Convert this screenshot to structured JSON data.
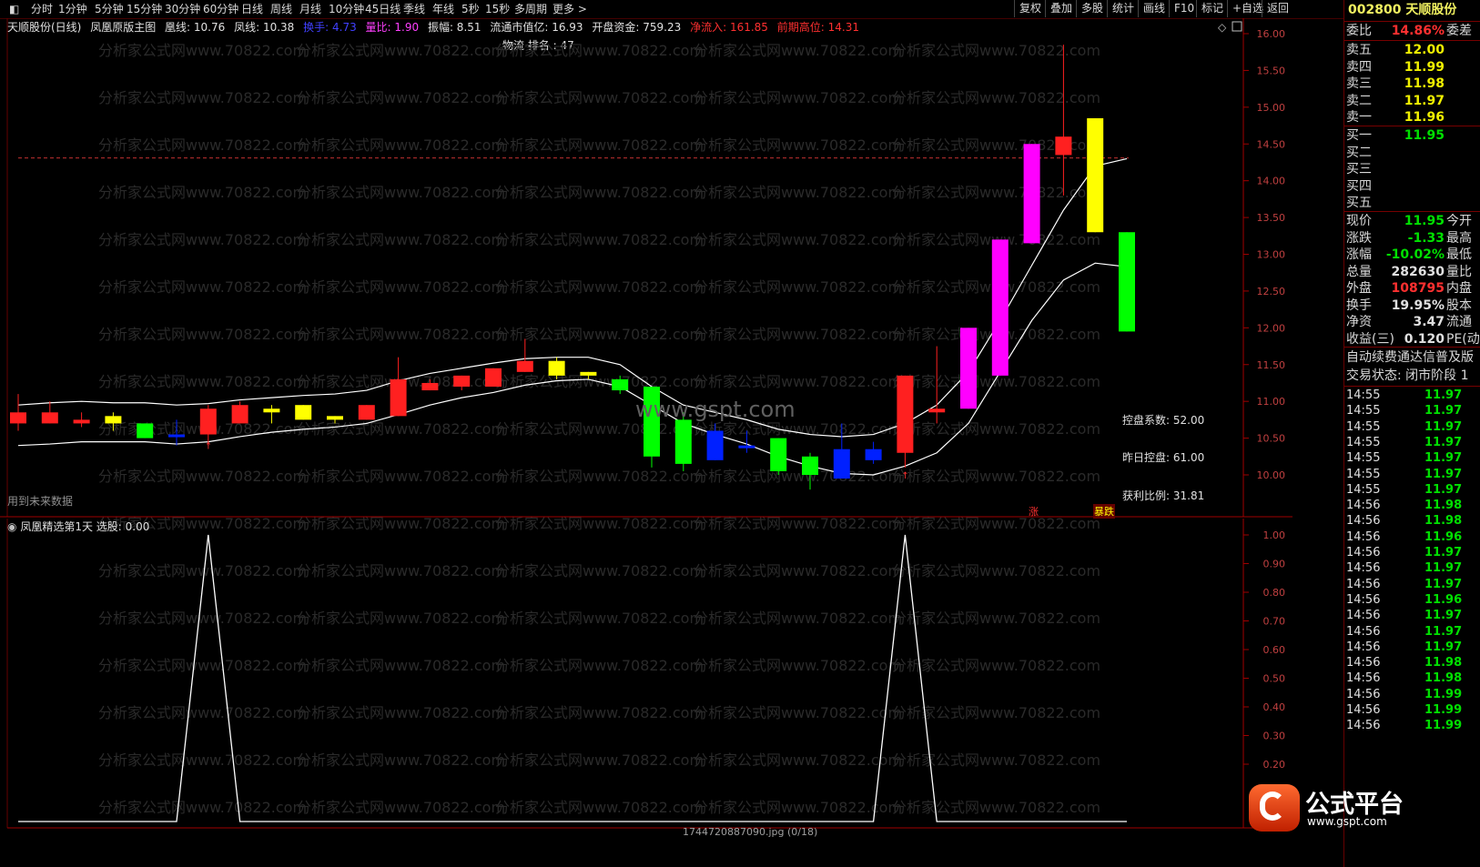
{
  "toolbar": {
    "periods": [
      "分时",
      "1分钟",
      "5分钟",
      "15分钟",
      "30分钟",
      "60分钟",
      "日线",
      "周线",
      "月线",
      "10分钟",
      "45日线",
      "季线",
      "年线",
      "5秒",
      "15秒",
      "多周期",
      "更多 >"
    ],
    "right_buttons": [
      "复权",
      "叠加",
      "多股",
      "统计",
      "画线",
      "F10",
      "标记",
      "+自选",
      "返回"
    ]
  },
  "info": {
    "stock": "天顺股份(日线)",
    "indicator": "凤凰原版主图",
    "huang": "凰线: 10.76",
    "feng": "凤线: 10.38",
    "huanshou": "换手: 4.73",
    "liangbi": "量比: 1.90",
    "zhenfu": "振幅: 8.51",
    "liutong": "流通市值亿: 16.93",
    "kaipan": "开盘资金: 759.23",
    "jingliu": "净流入: 161.85",
    "qianqi": "前期高位: 14.31",
    "wuliu": "物流 排名 : 47"
  },
  "main_chart": {
    "future_label": "用到未来数据",
    "kongpan": "控盘系数: 52.00",
    "zuori": "昨日控盘: 61.00",
    "huoli": "获利比例: 31.81",
    "zhang": "涨",
    "baodie": "暴跌",
    "watermark": "分析家公式网www.70822.com",
    "site": "www.gspt.com",
    "y_ticks": [
      "16.00",
      "15.50",
      "15.00",
      "14.50",
      "14.00",
      "13.50",
      "13.00",
      "12.50",
      "12.00",
      "11.50",
      "11.00",
      "10.50",
      "10.00"
    ],
    "colors": {
      "up": "#ff2020",
      "down": "#00ff00",
      "blue": "#0020ff",
      "yellow": "#ffff00",
      "magenta": "#ff00ff",
      "line": "#ffffff"
    },
    "candles": [
      [
        10.85,
        10.7,
        11.1,
        10.6,
        "up"
      ],
      [
        10.85,
        10.7,
        11.0,
        10.7,
        "up"
      ],
      [
        10.75,
        10.7,
        10.85,
        10.65,
        "up"
      ],
      [
        10.8,
        10.7,
        10.85,
        10.6,
        "yellow"
      ],
      [
        10.7,
        10.5,
        10.7,
        10.5,
        "down"
      ],
      [
        10.55,
        10.55,
        10.75,
        10.4,
        "blue"
      ],
      [
        10.9,
        10.55,
        10.95,
        10.4,
        "up"
      ],
      [
        10.95,
        10.7,
        11.0,
        10.7,
        "up"
      ],
      [
        10.9,
        10.85,
        10.95,
        10.7,
        "yellow"
      ],
      [
        10.95,
        10.75,
        10.95,
        10.75,
        "yellow"
      ],
      [
        10.8,
        10.75,
        10.8,
        10.7,
        "yellow"
      ],
      [
        10.95,
        10.75,
        10.95,
        10.75,
        "up"
      ],
      [
        11.3,
        10.8,
        11.6,
        10.8,
        "up"
      ],
      [
        11.25,
        11.15,
        11.3,
        11.15,
        "up"
      ],
      [
        11.35,
        11.2,
        11.35,
        11.15,
        "up"
      ],
      [
        11.45,
        11.2,
        11.45,
        11.2,
        "up"
      ],
      [
        11.55,
        11.4,
        11.85,
        11.4,
        "up"
      ],
      [
        11.55,
        11.35,
        11.6,
        11.3,
        "yellow"
      ],
      [
        11.4,
        11.35,
        11.4,
        11.3,
        "yellow"
      ],
      [
        11.3,
        11.15,
        11.35,
        11.1,
        "down"
      ],
      [
        11.2,
        10.25,
        11.2,
        10.1,
        "down"
      ],
      [
        10.75,
        10.15,
        10.85,
        10.05,
        "down"
      ],
      [
        10.6,
        10.2,
        10.7,
        10.2,
        "blue"
      ],
      [
        10.4,
        10.4,
        10.6,
        10.3,
        "blue"
      ],
      [
        10.5,
        10.05,
        10.5,
        10.0,
        "down"
      ],
      [
        10.25,
        10.0,
        10.3,
        9.8,
        "down"
      ],
      [
        10.35,
        9.95,
        10.7,
        9.95,
        "blue"
      ],
      [
        10.35,
        10.2,
        10.45,
        10.15,
        "blue"
      ],
      [
        11.35,
        10.3,
        11.35,
        10.1,
        "up"
      ],
      [
        10.9,
        10.85,
        11.75,
        10.7,
        "up"
      ],
      [
        12.0,
        10.9,
        12.0,
        10.9,
        "magenta"
      ],
      [
        13.2,
        11.35,
        13.2,
        11.35,
        "magenta"
      ],
      [
        14.5,
        13.15,
        14.5,
        13.15,
        "magenta"
      ],
      [
        14.6,
        14.35,
        15.85,
        13.8,
        "up"
      ],
      [
        14.85,
        13.3,
        14.85,
        13.3,
        "yellow"
      ],
      [
        13.3,
        11.95,
        13.3,
        11.95,
        "down"
      ]
    ],
    "huang_line": [
      10.95,
      10.98,
      11.0,
      10.98,
      10.98,
      10.95,
      10.97,
      11.02,
      11.05,
      11.08,
      11.1,
      11.15,
      11.28,
      11.38,
      11.45,
      11.52,
      11.58,
      11.6,
      11.6,
      11.5,
      11.2,
      10.95,
      10.85,
      10.75,
      10.62,
      10.55,
      10.52,
      10.55,
      10.7,
      10.95,
      11.4,
      12.1,
      12.85,
      13.6,
      14.2,
      14.3
    ],
    "feng_line": [
      10.4,
      10.42,
      10.45,
      10.45,
      10.45,
      10.42,
      10.45,
      10.52,
      10.58,
      10.62,
      10.65,
      10.7,
      10.82,
      10.95,
      11.05,
      11.12,
      11.22,
      11.28,
      11.3,
      11.2,
      10.95,
      10.7,
      10.55,
      10.42,
      10.25,
      10.12,
      10.02,
      10.0,
      10.12,
      10.3,
      10.7,
      11.4,
      12.1,
      12.65,
      12.88,
      12.83
    ]
  },
  "sub_chart": {
    "title": "凤凰精选第1天",
    "value": "选股: 0.00",
    "y_ticks": [
      "1.00",
      "0.90",
      "0.80",
      "0.70",
      "0.60",
      "0.50",
      "0.40",
      "0.30",
      "0.20"
    ],
    "signals": [
      0,
      0,
      0,
      0,
      0,
      0,
      1,
      0,
      0,
      0,
      0,
      0,
      0,
      0,
      0,
      0,
      0,
      0,
      0,
      0,
      0,
      0,
      0,
      0,
      0,
      0,
      0,
      0,
      1,
      0,
      0,
      0,
      0,
      0,
      0,
      0
    ],
    "footer": "1744720887090.jpg (0/18)"
  },
  "right_panel": {
    "code": "002800 天顺股份",
    "weibi": {
      "label": "委比",
      "value": "14.86%",
      "tail": "委差"
    },
    "sells": [
      {
        "label": "卖五",
        "price": "12.00"
      },
      {
        "label": "卖四",
        "price": "11.99"
      },
      {
        "label": "卖三",
        "price": "11.98"
      },
      {
        "label": "卖二",
        "price": "11.97"
      },
      {
        "label": "卖一",
        "price": "11.96"
      }
    ],
    "buys": [
      {
        "label": "买一",
        "price": "11.95"
      },
      {
        "label": "买二",
        "price": ""
      },
      {
        "label": "买三",
        "price": ""
      },
      {
        "label": "买四",
        "price": ""
      },
      {
        "label": "买五",
        "price": ""
      }
    ],
    "stats": [
      {
        "label": "现价",
        "value": "11.95",
        "tail": "今开",
        "cls": "dn"
      },
      {
        "label": "涨跌",
        "value": "-1.33",
        "tail": "最高",
        "cls": "dn"
      },
      {
        "label": "涨幅",
        "value": "-10.02%",
        "tail": "最低",
        "cls": "dn"
      },
      {
        "label": "总量",
        "value": "282630",
        "tail": "量比",
        "cls": "wt"
      },
      {
        "label": "外盘",
        "value": "108795",
        "tail": "内盘",
        "cls": "up"
      },
      {
        "label": "换手",
        "value": "19.95%",
        "tail": "股本",
        "cls": "wt"
      },
      {
        "label": "净资",
        "value": "3.47",
        "tail": "流通",
        "cls": "wt"
      },
      {
        "label": "收益(三)",
        "value": "0.120",
        "tail": "PE(动",
        "cls": "wt"
      }
    ],
    "notice1": "自动续费通达信普及版",
    "notice2": "交易状态: 闭市阶段 1",
    "ticks": [
      [
        "14:55",
        "11.97"
      ],
      [
        "14:55",
        "11.97"
      ],
      [
        "14:55",
        "11.97"
      ],
      [
        "14:55",
        "11.97"
      ],
      [
        "14:55",
        "11.97"
      ],
      [
        "14:55",
        "11.97"
      ],
      [
        "14:55",
        "11.97"
      ],
      [
        "14:56",
        "11.98"
      ],
      [
        "14:56",
        "11.98"
      ],
      [
        "14:56",
        "11.96"
      ],
      [
        "14:56",
        "11.97"
      ],
      [
        "14:56",
        "11.97"
      ],
      [
        "14:56",
        "11.97"
      ],
      [
        "14:56",
        "11.96"
      ],
      [
        "14:56",
        "11.97"
      ],
      [
        "14:56",
        "11.97"
      ],
      [
        "14:56",
        "11.97"
      ],
      [
        "14:56",
        "11.98"
      ],
      [
        "14:56",
        "11.98"
      ],
      [
        "14:56",
        "11.99"
      ],
      [
        "14:56",
        "11.99"
      ],
      [
        "14:56",
        "11.99"
      ]
    ],
    "logo_text": "公式平台",
    "logo_url": "www.gspt.com"
  }
}
